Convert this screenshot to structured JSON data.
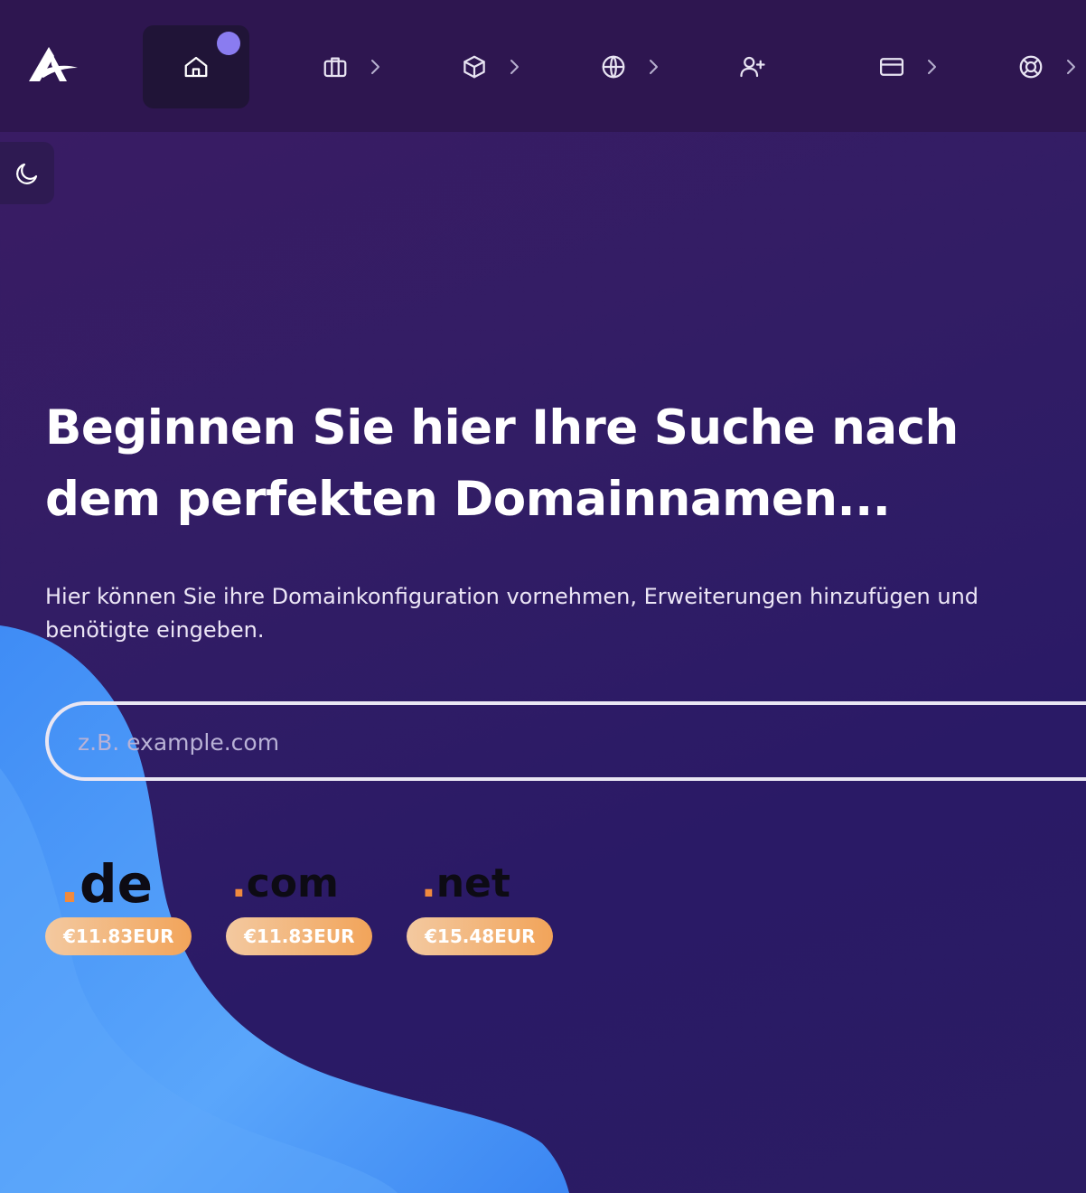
{
  "nav": {
    "items": [
      {
        "icon": "home-icon",
        "active": true,
        "has_badge": true,
        "has_chevron": false
      },
      {
        "icon": "briefcase-icon",
        "active": false,
        "has_chevron": true
      },
      {
        "icon": "box-icon",
        "active": false,
        "has_chevron": true
      },
      {
        "icon": "globe-icon",
        "active": false,
        "has_chevron": true
      },
      {
        "icon": "user-plus-icon",
        "active": false,
        "has_chevron": false
      },
      {
        "icon": "credit-card-icon",
        "active": false,
        "has_chevron": true
      },
      {
        "icon": "lifebuoy-icon",
        "active": false,
        "has_chevron": true
      }
    ]
  },
  "theme_toggle": {
    "icon": "moon-icon"
  },
  "hero": {
    "title": "Beginnen Sie hier Ihre Suche nach dem perfekten Domainnamen...",
    "subtitle": "Hier können Sie ihre Domainkonfiguration vornehmen, Erweiterungen hinzufügen und benötigte eingeben."
  },
  "search": {
    "placeholder": "z.B. example.com",
    "value": ""
  },
  "tlds": [
    {
      "dot": ".",
      "name": "de",
      "price": "€11.83EUR"
    },
    {
      "dot": ".",
      "name": "com",
      "price": "€11.83EUR"
    },
    {
      "dot": ".",
      "name": "net",
      "price": "€15.48EUR"
    }
  ],
  "colors": {
    "background": "#321d65",
    "nav_background": "#2e1650",
    "accent_orange": "#f08a3e",
    "badge_purple": "#8a7cf0",
    "wave_blue": "#4d96f5"
  }
}
